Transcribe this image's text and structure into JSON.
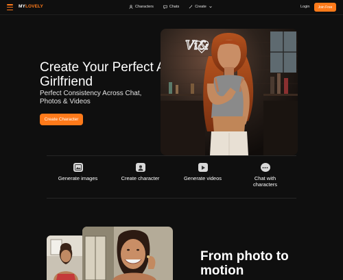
{
  "header": {
    "logo_main": "MY",
    "logo_accent": "LOVELY",
    "nav": [
      {
        "label": "Characters",
        "icon": "user-icon"
      },
      {
        "label": "Chats",
        "icon": "chat-icon"
      },
      {
        "label": "Create",
        "icon": "wand-icon"
      }
    ],
    "login_label": "Login",
    "join_label": "Join Free"
  },
  "hero": {
    "title": "Create Your Perfect AI Girlfriend",
    "subtitle": "Perfect Consistency Across Chat, Photos & Videos",
    "cta_label": "Create Character",
    "image_sign_text": "Vi&"
  },
  "features": [
    {
      "label": "Generate images",
      "icon": "image-icon"
    },
    {
      "label": "Create character",
      "icon": "user-card-icon"
    },
    {
      "label": "Generate videos",
      "icon": "play-icon"
    },
    {
      "label": "Chat with characters",
      "icon": "chat-bubble-icon"
    }
  ],
  "motion": {
    "title": "From photo to motion"
  },
  "colors": {
    "accent": "#ff7a1a",
    "background": "#0f0f0f"
  }
}
